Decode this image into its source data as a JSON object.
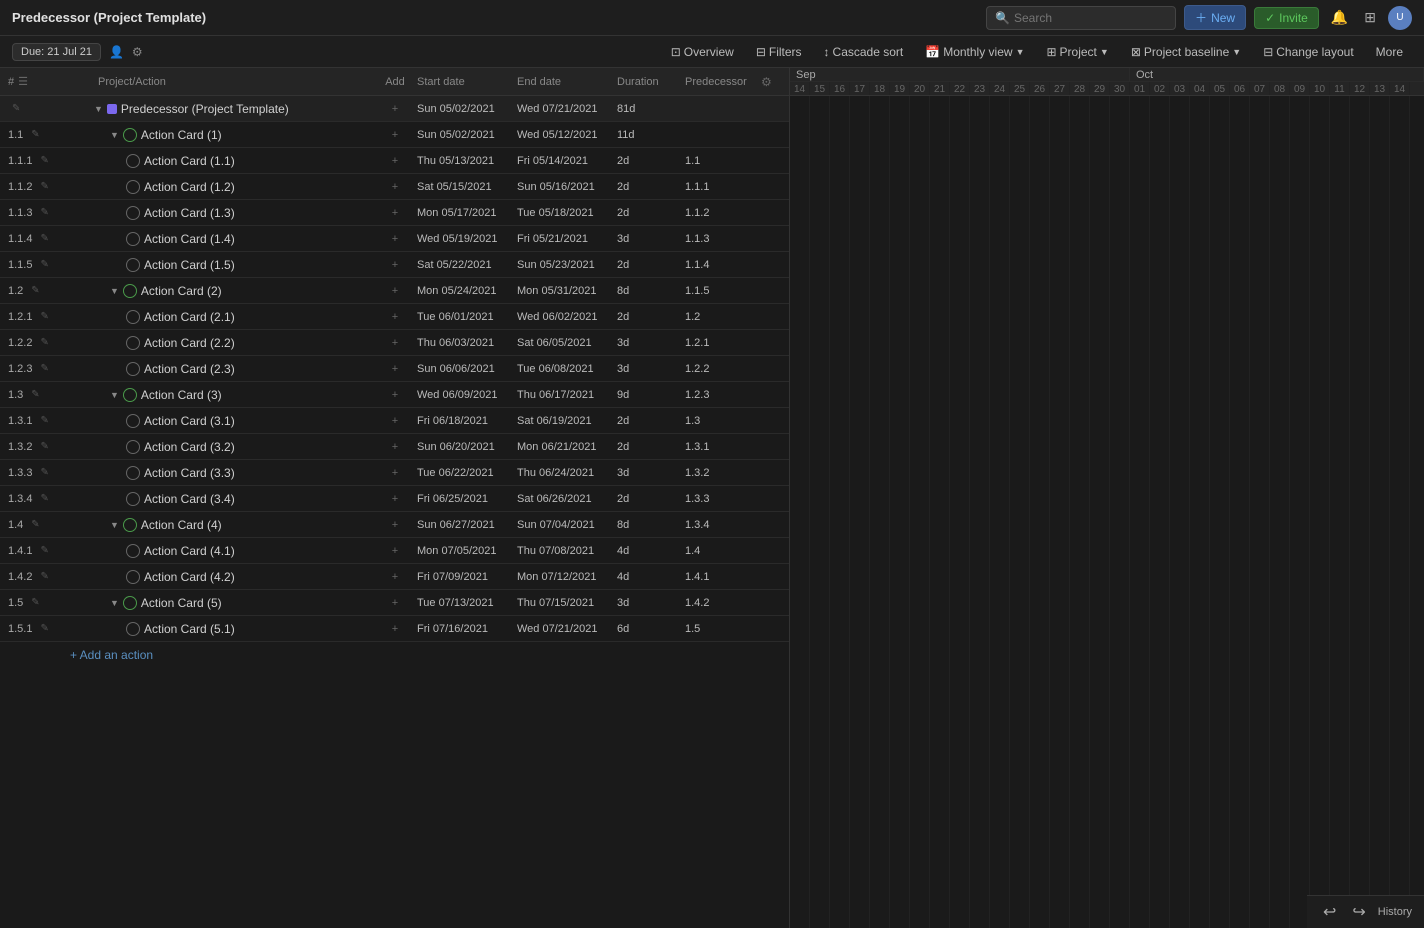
{
  "app": {
    "title": "Predecessor (Project Template)"
  },
  "topbar": {
    "search_placeholder": "Search",
    "new_label": "New",
    "invite_label": "Invite"
  },
  "subbar": {
    "due_label": "Due: 21 Jul 21",
    "overview_label": "Overview",
    "filters_label": "Filters",
    "cascade_sort_label": "Cascade sort",
    "monthly_view_label": "Monthly view",
    "project_label": "Project",
    "project_baseline_label": "Project baseline",
    "change_layout_label": "Change layout",
    "more_label": "More"
  },
  "table": {
    "columns": {
      "num": "#",
      "project": "Project/Action",
      "add": "Add",
      "start": "Start date",
      "end": "End date",
      "duration": "Duration",
      "predecessor": "Predecessor"
    },
    "rows": [
      {
        "id": "",
        "level": 0,
        "type": "project",
        "name": "Predecessor (Project Template)",
        "start": "Sun 05/02/2021",
        "end": "Wed 07/21/2021",
        "duration": "81d",
        "predecessor": ""
      },
      {
        "id": "1.1",
        "level": 1,
        "type": "group",
        "name": "Action Card (1)",
        "start": "Sun 05/02/2021",
        "end": "Wed 05/12/2021",
        "duration": "11d",
        "predecessor": ""
      },
      {
        "id": "1.1.1",
        "level": 2,
        "type": "task",
        "name": "Action Card (1.1)",
        "start": "Thu 05/13/2021",
        "end": "Fri 05/14/2021",
        "duration": "2d",
        "predecessor": "1.1"
      },
      {
        "id": "1.1.2",
        "level": 2,
        "type": "task",
        "name": "Action Card (1.2)",
        "start": "Sat 05/15/2021",
        "end": "Sun 05/16/2021",
        "duration": "2d",
        "predecessor": "1.1.1"
      },
      {
        "id": "1.1.3",
        "level": 2,
        "type": "task",
        "name": "Action Card (1.3)",
        "start": "Mon 05/17/2021",
        "end": "Tue 05/18/2021",
        "duration": "2d",
        "predecessor": "1.1.2"
      },
      {
        "id": "1.1.4",
        "level": 2,
        "type": "task",
        "name": "Action Card (1.4)",
        "start": "Wed 05/19/2021",
        "end": "Fri 05/21/2021",
        "duration": "3d",
        "predecessor": "1.1.3"
      },
      {
        "id": "1.1.5",
        "level": 2,
        "type": "task",
        "name": "Action Card (1.5)",
        "start": "Sat 05/22/2021",
        "end": "Sun 05/23/2021",
        "duration": "2d",
        "predecessor": "1.1.4"
      },
      {
        "id": "1.2",
        "level": 1,
        "type": "group",
        "name": "Action Card (2)",
        "start": "Mon 05/24/2021",
        "end": "Mon 05/31/2021",
        "duration": "8d",
        "predecessor": "1.1.5"
      },
      {
        "id": "1.2.1",
        "level": 2,
        "type": "task",
        "name": "Action Card (2.1)",
        "start": "Tue 06/01/2021",
        "end": "Wed 06/02/2021",
        "duration": "2d",
        "predecessor": "1.2"
      },
      {
        "id": "1.2.2",
        "level": 2,
        "type": "task",
        "name": "Action Card (2.2)",
        "start": "Thu 06/03/2021",
        "end": "Sat 06/05/2021",
        "duration": "3d",
        "predecessor": "1.2.1"
      },
      {
        "id": "1.2.3",
        "level": 2,
        "type": "task",
        "name": "Action Card (2.3)",
        "start": "Sun 06/06/2021",
        "end": "Tue 06/08/2021",
        "duration": "3d",
        "predecessor": "1.2.2"
      },
      {
        "id": "1.3",
        "level": 1,
        "type": "group",
        "name": "Action Card (3)",
        "start": "Wed 06/09/2021",
        "end": "Thu 06/17/2021",
        "duration": "9d",
        "predecessor": "1.2.3"
      },
      {
        "id": "1.3.1",
        "level": 2,
        "type": "task",
        "name": "Action Card (3.1)",
        "start": "Fri 06/18/2021",
        "end": "Sat 06/19/2021",
        "duration": "2d",
        "predecessor": "1.3"
      },
      {
        "id": "1.3.2",
        "level": 2,
        "type": "task",
        "name": "Action Card (3.2)",
        "start": "Sun 06/20/2021",
        "end": "Mon 06/21/2021",
        "duration": "2d",
        "predecessor": "1.3.1"
      },
      {
        "id": "1.3.3",
        "level": 2,
        "type": "task",
        "name": "Action Card (3.3)",
        "start": "Tue 06/22/2021",
        "end": "Thu 06/24/2021",
        "duration": "3d",
        "predecessor": "1.3.2"
      },
      {
        "id": "1.3.4",
        "level": 2,
        "type": "task",
        "name": "Action Card (3.4)",
        "start": "Fri 06/25/2021",
        "end": "Sat 06/26/2021",
        "duration": "2d",
        "predecessor": "1.3.3"
      },
      {
        "id": "1.4",
        "level": 1,
        "type": "group",
        "name": "Action Card (4)",
        "start": "Sun 06/27/2021",
        "end": "Sun 07/04/2021",
        "duration": "8d",
        "predecessor": "1.3.4"
      },
      {
        "id": "1.4.1",
        "level": 2,
        "type": "task",
        "name": "Action Card (4.1)",
        "start": "Mon 07/05/2021",
        "end": "Thu 07/08/2021",
        "duration": "4d",
        "predecessor": "1.4"
      },
      {
        "id": "1.4.2",
        "level": 2,
        "type": "task",
        "name": "Action Card (4.2)",
        "start": "Fri 07/09/2021",
        "end": "Mon 07/12/2021",
        "duration": "4d",
        "predecessor": "1.4.1"
      },
      {
        "id": "1.5",
        "level": 1,
        "type": "group",
        "name": "Action Card (5)",
        "start": "Tue 07/13/2021",
        "end": "Thu 07/15/2021",
        "duration": "3d",
        "predecessor": "1.4.2"
      },
      {
        "id": "1.5.1",
        "level": 2,
        "type": "task",
        "name": "Action Card (5.1)",
        "start": "Fri 07/16/2021",
        "end": "Wed 07/21/2021",
        "duration": "6d",
        "predecessor": "1.5"
      }
    ],
    "add_action_label": "+ Add an action"
  },
  "gantt": {
    "months": [
      {
        "label": "Sep",
        "days": [
          "14",
          "15",
          "16",
          "17",
          "18",
          "19",
          "20",
          "21",
          "22",
          "23",
          "24",
          "25",
          "26",
          "27",
          "28",
          "29",
          "30"
        ]
      },
      {
        "label": "Oct",
        "days": [
          "01",
          "02",
          "03",
          "04",
          "05",
          "06",
          "07",
          "08",
          "09",
          "10",
          "11",
          "12",
          "13",
          "14"
        ]
      }
    ]
  },
  "bottom": {
    "history_label": "History",
    "undo_icon": "↩",
    "redo_icon": "↪"
  }
}
